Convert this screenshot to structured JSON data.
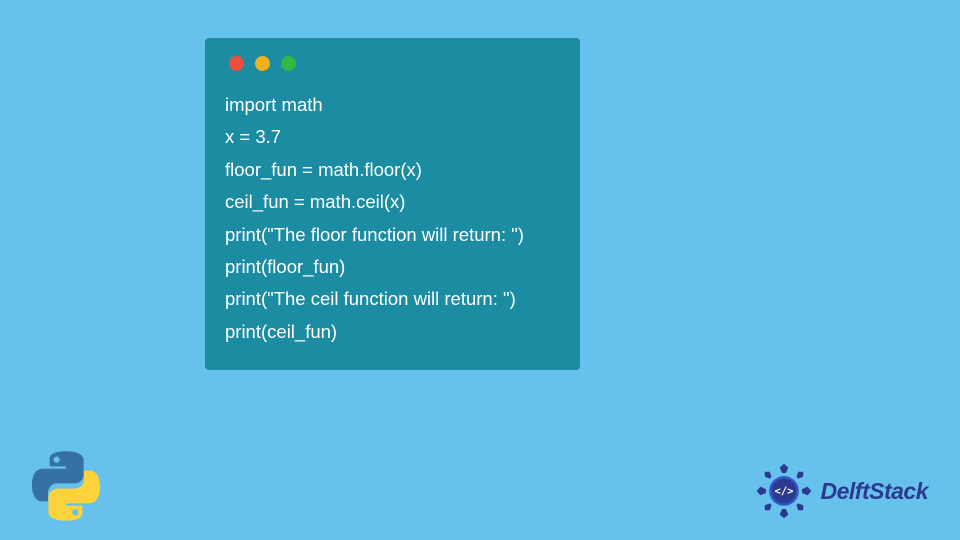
{
  "code": {
    "lines": [
      "import math",
      "x = 3.7",
      "floor_fun = math.floor(x)",
      "ceil_fun = math.ceil(x)",
      "print(\"The floor function will return: \")",
      "print(floor_fun)",
      "print(\"The ceil function will return: \")",
      "print(ceil_fun)"
    ]
  },
  "branding": {
    "delftstack_label": "DelftStack"
  },
  "colors": {
    "background": "#66c2ed",
    "window_bg": "#1c8ca3",
    "dot_red": "#ed4e3e",
    "dot_yellow": "#f0b11e",
    "dot_green": "#30b944",
    "code_text": "#ffffff",
    "delft_text": "#2a3b8f"
  }
}
